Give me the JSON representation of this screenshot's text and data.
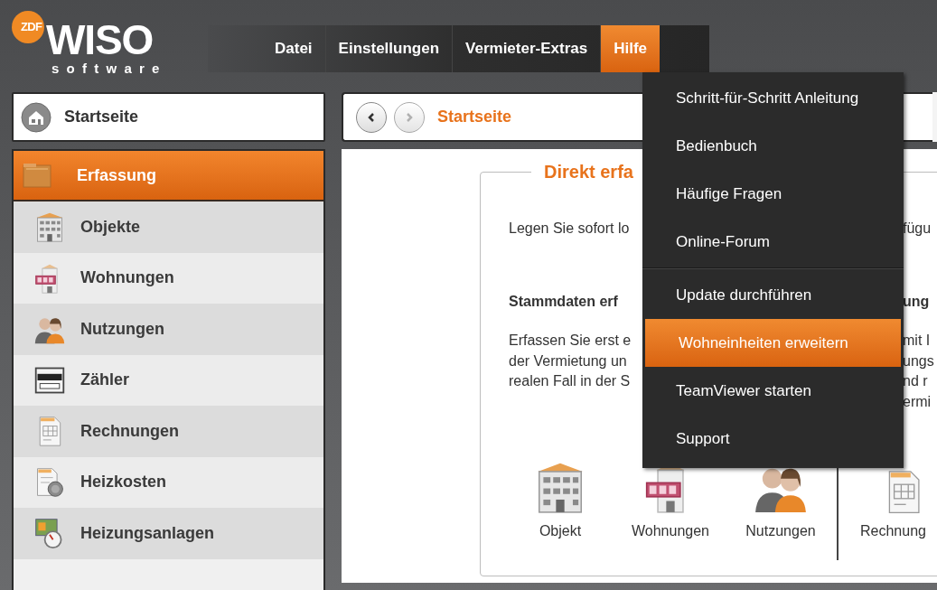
{
  "logo": {
    "badge": "ZDF",
    "name": "WISO",
    "tagline": "software"
  },
  "menubar": [
    {
      "label": "Datei",
      "selected": false
    },
    {
      "label": "Einstellungen",
      "selected": false
    },
    {
      "label": "Vermieter-Extras",
      "selected": false
    },
    {
      "label": "Hilfe",
      "selected": true
    }
  ],
  "sidebar": {
    "home": {
      "label": "Startseite"
    },
    "section": {
      "label": "Erfassung"
    },
    "items": [
      {
        "label": "Objekte",
        "kind": "building"
      },
      {
        "label": "Wohnungen",
        "kind": "flat"
      },
      {
        "label": "Nutzungen",
        "kind": "people"
      },
      {
        "label": "Zähler",
        "kind": "meter"
      },
      {
        "label": "Rechnungen",
        "kind": "invoice"
      },
      {
        "label": "Heizkosten",
        "kind": "heating_costs"
      },
      {
        "label": "Heizungsanlagen",
        "kind": "heating_system"
      }
    ]
  },
  "breadcrumb": {
    "back": {
      "disabled": false
    },
    "forward": {
      "disabled": true
    },
    "label": "Startseite"
  },
  "panel": {
    "title": "Direkt erfa",
    "lines": [
      {
        "kind": "intro",
        "left": "Legen Sie sofort lo",
        "right": "fügu"
      },
      {
        "kind": "heading",
        "left": "Stammdaten erf",
        "right": "ung"
      },
      {
        "kind": "text",
        "left": "Erfassen Sie erst e",
        "right": "mit I"
      },
      {
        "kind": "text",
        "left": "der Vermietung un",
        "right": "ungs"
      },
      {
        "kind": "text",
        "left": "realen Fall in der S",
        "right": "nd r"
      },
      {
        "kind": "text",
        "right": "ermi"
      }
    ],
    "shortcut_groups": [
      [
        {
          "label": "Objekt",
          "kind": "building"
        },
        {
          "label": "Wohnungen",
          "kind": "flat"
        },
        {
          "label": "Nutzungen",
          "kind": "people"
        }
      ],
      [
        {
          "label": "Rechnung",
          "kind": "invoice"
        }
      ]
    ]
  },
  "help_menu": {
    "groups": [
      [
        {
          "label": "Schritt-für-Schritt Anleitung",
          "selected": false
        },
        {
          "label": "Bedienbuch",
          "selected": false
        },
        {
          "label": "Häufige Fragen",
          "selected": false
        },
        {
          "label": "Online-Forum",
          "selected": false
        }
      ],
      [
        {
          "label": "Update durchführen",
          "selected": false
        },
        {
          "label": "Wohneinheiten erweitern",
          "selected": true
        },
        {
          "label": "TeamViewer starten",
          "selected": false
        },
        {
          "label": "Support",
          "selected": false
        }
      ]
    ]
  }
}
